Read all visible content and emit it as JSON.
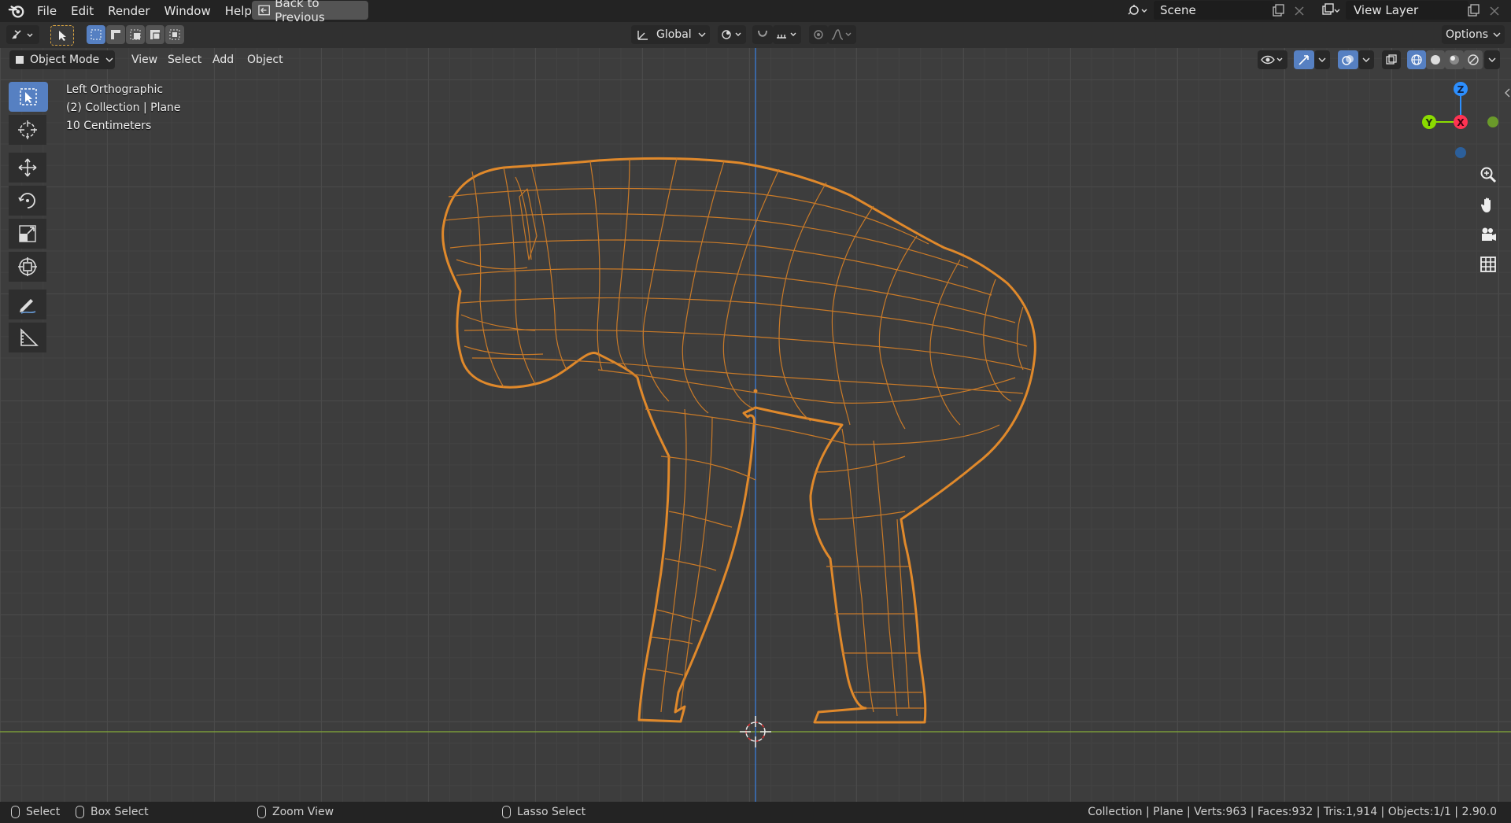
{
  "app": {
    "logo_icon": "blender-logo-icon"
  },
  "menu": [
    "File",
    "Edit",
    "Render",
    "Window",
    "Help"
  ],
  "back_button": "Back to Previous",
  "scene": {
    "label": "Scene",
    "icon": "scene-icon"
  },
  "view_layer": {
    "label": "View Layer",
    "icon": "view-layer-icon"
  },
  "tool_header": {
    "transform_orientation": "Global",
    "options_label": "Options"
  },
  "view_header": {
    "mode": "Object Mode",
    "menus": [
      "View",
      "Select",
      "Add",
      "Object"
    ]
  },
  "overlay": {
    "view_name": "Left Orthographic",
    "collection": "(2) Collection | Plane",
    "scale": "10 Centimeters"
  },
  "toolbar": [
    "select-box-tool",
    "cursor-tool",
    "move-tool",
    "rotate-tool",
    "scale-tool",
    "transform-tool",
    "annotate-tool",
    "measure-tool"
  ],
  "gizmo": {
    "axes": [
      "Z",
      "Y",
      "X"
    ]
  },
  "colors": {
    "accent": "#5680c2",
    "wire": "#e0892b",
    "x_axis": "#ff3352",
    "y_axis": "#8bdc00",
    "z_axis": "#2c8fff",
    "grid": "#4a4a4a"
  },
  "status": {
    "select": "Select",
    "box_select": "Box Select",
    "zoom": "Zoom View",
    "lasso": "Lasso Select",
    "stats": "Collection | Plane | Verts:963 | Faces:932 | Tris:1,914 | Objects:1/1 | 2.90.0"
  }
}
